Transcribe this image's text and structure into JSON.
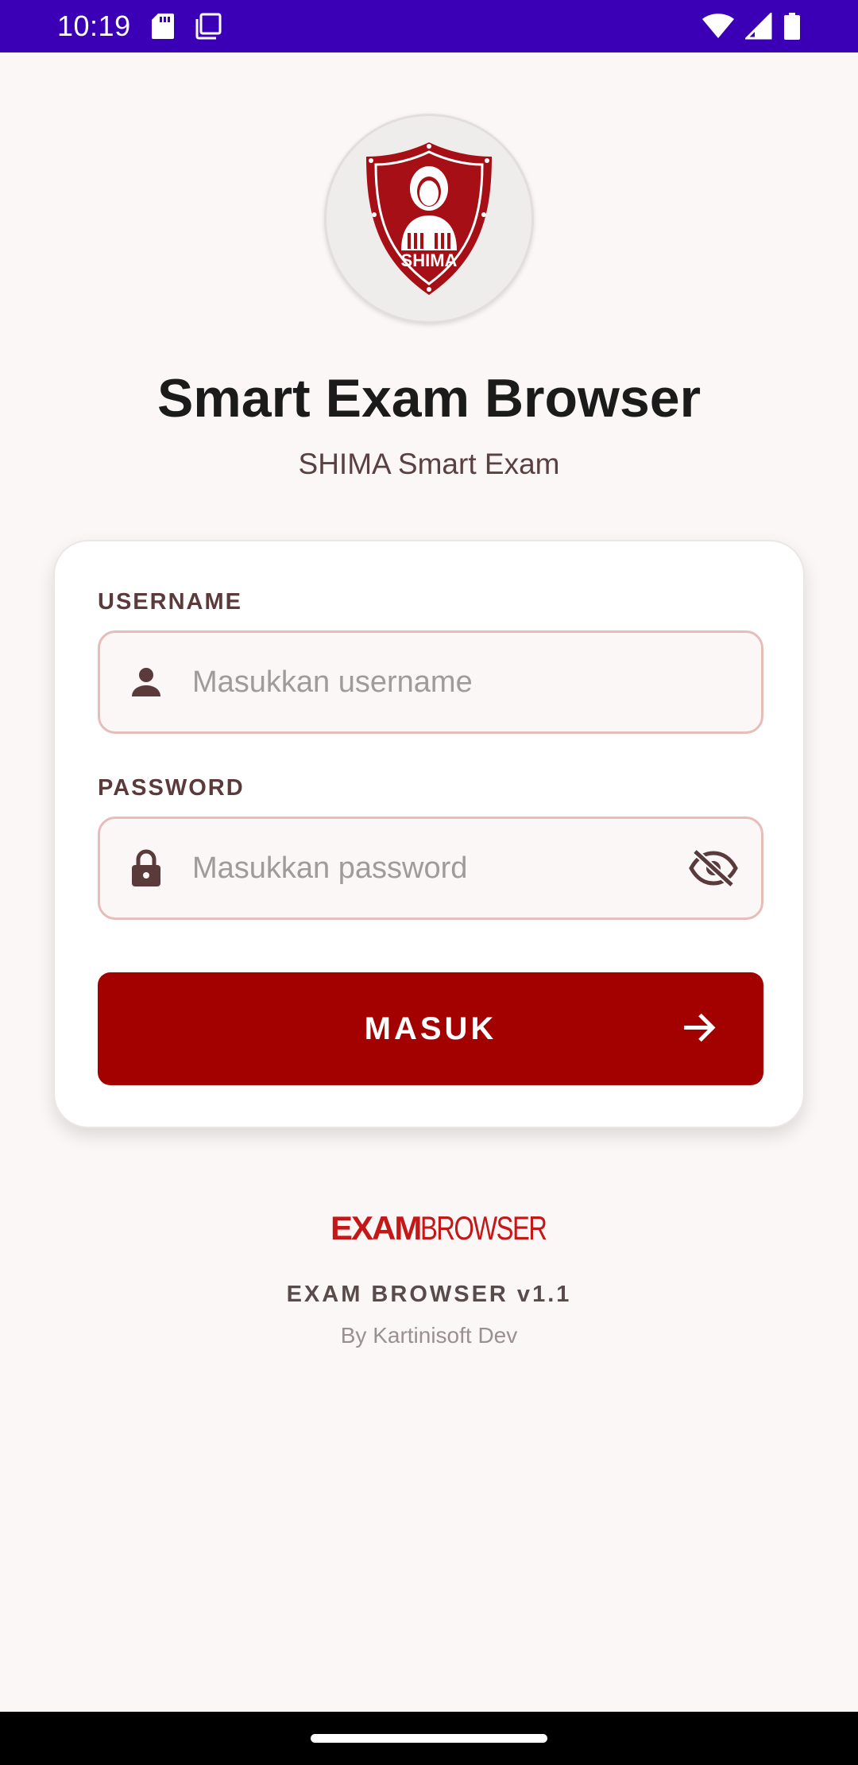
{
  "status_bar": {
    "time": "10:19",
    "icons": [
      "sd-card-icon",
      "screenshot-icon",
      "wifi-icon",
      "signal-icon",
      "battery-icon"
    ]
  },
  "app": {
    "logo_icon": "shima-shield-logo",
    "logo_text": "SHIMA",
    "title": "Smart Exam Browser",
    "subtitle": "SHIMA Smart Exam"
  },
  "form": {
    "username_label": "USERNAME",
    "username_placeholder": "Masukkan username",
    "username_value": "",
    "username_icon": "person-icon",
    "password_label": "PASSWORD",
    "password_placeholder": "Masukkan password",
    "password_value": "",
    "password_icon": "lock-icon",
    "toggle_icon": "eye-off-icon",
    "submit_label": "MASUK",
    "submit_icon": "arrow-right-icon"
  },
  "footer": {
    "brand_bold": "EXAM",
    "brand_light": "BROWSER",
    "version": "EXAM BROWSER v1.1",
    "developer": "By Kartinisoft Dev"
  },
  "colors": {
    "status_bar": "#3b00b6",
    "accent": "#a30000",
    "input_border": "#e6bdb8",
    "background": "#faf7f6"
  }
}
